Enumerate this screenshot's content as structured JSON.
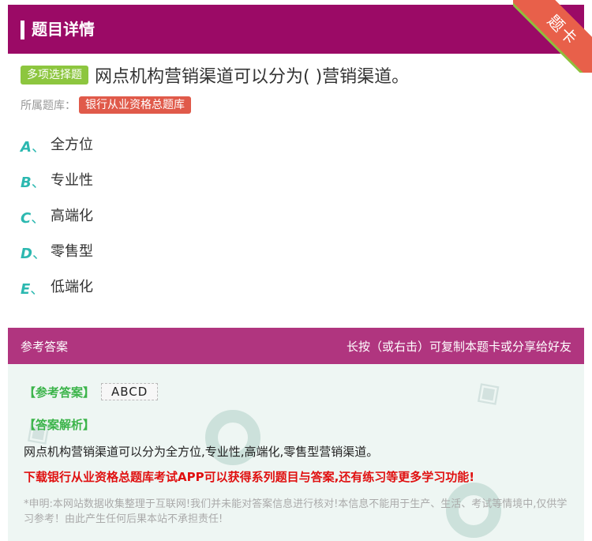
{
  "header": {
    "title": "题目详情"
  },
  "ribbon": {
    "label": "题卡"
  },
  "question": {
    "type_label": "多项选择题",
    "text": "网点机构营销渠道可以分为( )营销渠道。",
    "bank_label": "所属题库：",
    "bank_name": "银行从业资格总题库"
  },
  "options": [
    {
      "letter": "A",
      "sep": "、",
      "text": "全方位"
    },
    {
      "letter": "B",
      "sep": "、",
      "text": "专业性"
    },
    {
      "letter": "C",
      "sep": "、",
      "text": "高端化"
    },
    {
      "letter": "D",
      "sep": "、",
      "text": "零售型"
    },
    {
      "letter": "E",
      "sep": "、",
      "text": "低端化"
    }
  ],
  "answer_header": {
    "left": "参考答案",
    "right": "长按（或右击）可复制本题卡或分享给好友"
  },
  "answer": {
    "tag": "【参考答案】",
    "value": "ABCD",
    "analysis_tag": "【答案解析】",
    "analysis_text": "网点机构营销渠道可以分为全方位,专业性,高端化,零售型营销渠道。",
    "promo": "下载银行从业资格总题库考试APP可以获得系列题目与答案,还有练习等更多学习功能!",
    "disclaimer": "*申明:本网站数据收集整理于互联网!我们并未能对答案信息进行核对!本信息不能用于生产、生活、考试等情境中,仅供学习参考！由此产生任何后果本站不承担责任!"
  },
  "colors": {
    "header_bg": "#9b0a66",
    "answer_head_bg": "#b0357f",
    "type_badge": "#8dc63f",
    "bank_badge": "#e05a4a",
    "option_letter": "#2cb8b0",
    "answer_tag": "#3bb44a",
    "promo": "#e01010"
  }
}
